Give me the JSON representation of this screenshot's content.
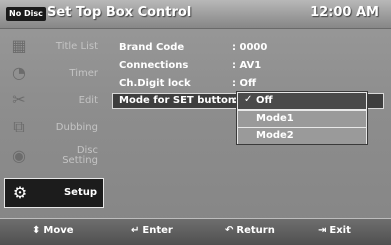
{
  "header": {
    "disc_badge": "No Disc",
    "title": "Set Top Box Control",
    "time": "12:00 AM"
  },
  "sidebar": {
    "items": [
      {
        "label": "Title List",
        "icon": "film-icon"
      },
      {
        "label": "Timer",
        "icon": "clock-icon"
      },
      {
        "label": "Edit",
        "icon": "scissors-icon"
      },
      {
        "label": "Dubbing",
        "icon": "dubbing-icon"
      },
      {
        "label": "Disc Setting",
        "icon": "disc-icon"
      },
      {
        "label": "Setup",
        "icon": "gear-icon",
        "active": true
      }
    ]
  },
  "settings": [
    {
      "key": "Brand Code",
      "value": ": 0000"
    },
    {
      "key": "Connections",
      "value": ": AV1"
    },
    {
      "key": "Ch.Digit lock",
      "value": ": Off"
    },
    {
      "key": "Mode for SET button",
      "value": ":"
    }
  ],
  "dropdown": {
    "options": [
      "Off",
      "Mode1",
      "Mode2"
    ],
    "selected": "Off"
  },
  "footer": {
    "move": "Move",
    "enter": "Enter",
    "return": "Return",
    "exit": "Exit"
  }
}
